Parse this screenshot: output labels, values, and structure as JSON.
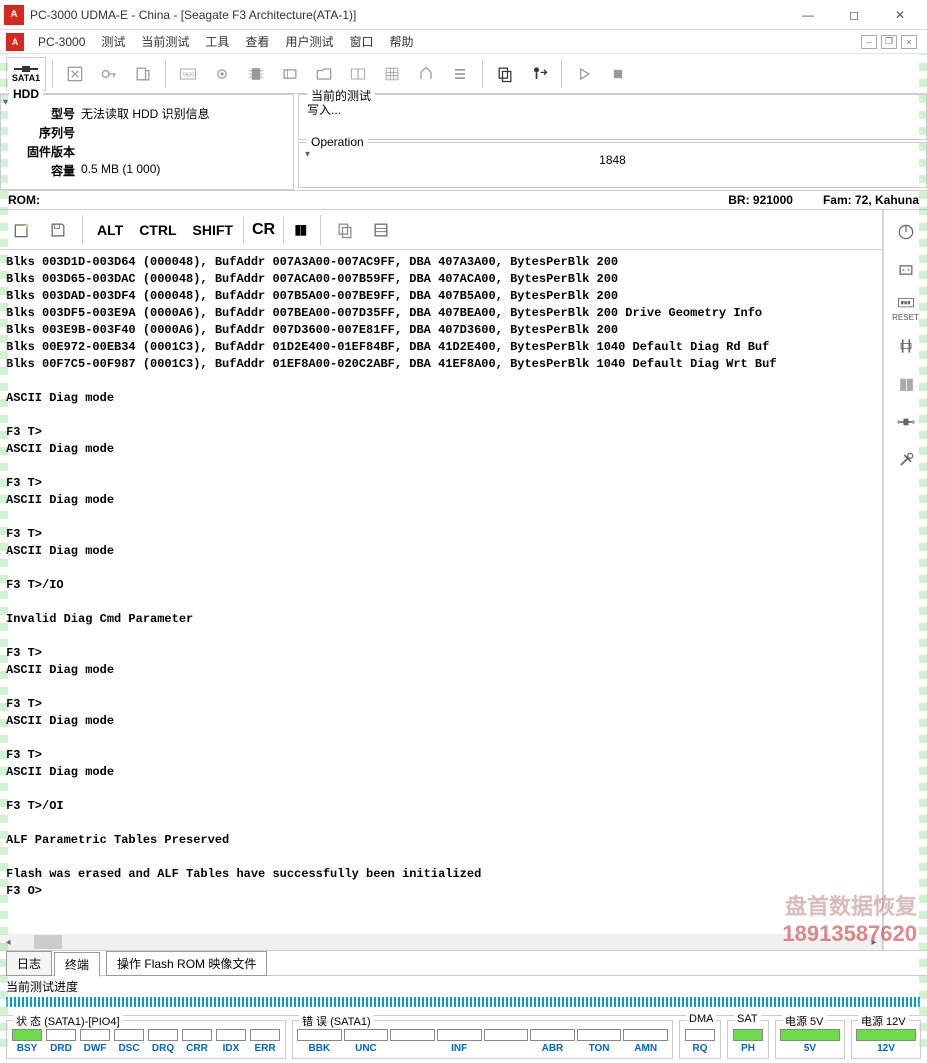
{
  "titlebar": {
    "title": "PC-3000 UDMA-E - China - [Seagate F3 Architecture(ATA-1)]"
  },
  "menubar": {
    "app": "PC-3000",
    "items": [
      "测试",
      "当前测试",
      "工具",
      "查看",
      "用户测试",
      "窗口",
      "帮助"
    ]
  },
  "toolbar": {
    "sata": "SATA1"
  },
  "hdd": {
    "panel_label": "HDD",
    "model_lbl": "型号",
    "model_val": "无法读取 HDD 识别信息",
    "serial_lbl": "序列号",
    "serial_val": "",
    "fw_lbl": "固件版本",
    "fw_val": "",
    "cap_lbl": "容量",
    "cap_val": "0.5 MB (1 000)"
  },
  "test_panel": {
    "label": "当前的测试",
    "value": "写入..."
  },
  "op_panel": {
    "label": "Operation",
    "value": "1848"
  },
  "rom_line": {
    "rom": "ROM:",
    "br": "BR: 921000",
    "fam": "Fam: 72, Kahuna"
  },
  "term_toolbar": {
    "alt": "ALT",
    "ctrl": "CTRL",
    "shift": "SHIFT",
    "cr": "CR"
  },
  "terminal_text": "Blks 003D1D-003D64 (000048), BufAddr 007A3A00-007AC9FF, DBA 407A3A00, BytesPerBlk 200\nBlks 003D65-003DAC (000048), BufAddr 007ACA00-007B59FF, DBA 407ACA00, BytesPerBlk 200\nBlks 003DAD-003DF4 (000048), BufAddr 007B5A00-007BE9FF, DBA 407B5A00, BytesPerBlk 200\nBlks 003DF5-003E9A (0000A6), BufAddr 007BEA00-007D35FF, DBA 407BEA00, BytesPerBlk 200 Drive Geometry Info\nBlks 003E9B-003F40 (0000A6), BufAddr 007D3600-007E81FF, DBA 407D3600, BytesPerBlk 200\nBlks 00E972-00EB34 (0001C3), BufAddr 01D2E400-01EF84BF, DBA 41D2E400, BytesPerBlk 1040 Default Diag Rd Buf\nBlks 00F7C5-00F987 (0001C3), BufAddr 01EF8A00-020C2ABF, DBA 41EF8A00, BytesPerBlk 1040 Default Diag Wrt Buf\n\nASCII Diag mode\n\nF3 T>\nASCII Diag mode\n\nF3 T>\nASCII Diag mode\n\nF3 T>\nASCII Diag mode\n\nF3 T>/IO\n\nInvalid Diag Cmd Parameter\n\nF3 T>\nASCII Diag mode\n\nF3 T>\nASCII Diag mode\n\nF3 T>\nASCII Diag mode\n\nF3 T>/OI\n\nALF Parametric Tables Preserved\n\nFlash was erased and ALF Tables have successfully been initialized\nF3 O>",
  "tabs": {
    "log": "日志",
    "terminal": "终端",
    "op": "操作 Flash ROM 映像文件"
  },
  "progress": {
    "label": "当前测试进度"
  },
  "watermark": {
    "line1": "盘首数据恢复",
    "line2": "18913587620"
  },
  "status": {
    "state_label": "状 态 (SATA1)-[PIO4]",
    "err_label": "错 误 (SATA1)",
    "dma_label": "DMA",
    "sat_label": "SAT",
    "p5_label": "电源 5V",
    "p12_label": "电源 12V",
    "state_leds": [
      "BSY",
      "DRD",
      "DWF",
      "DSC",
      "DRQ",
      "CRR",
      "IDX",
      "ERR"
    ],
    "err_leds": [
      "BBK",
      "UNC",
      "",
      "INF",
      "",
      "ABR",
      "TON",
      "AMN"
    ],
    "dma_leds": [
      "RQ"
    ],
    "sat_leds": [
      "PH"
    ],
    "p5_leds": [
      "5V"
    ],
    "p12_leds": [
      "12V"
    ]
  },
  "right_tools_reset": "RESET"
}
